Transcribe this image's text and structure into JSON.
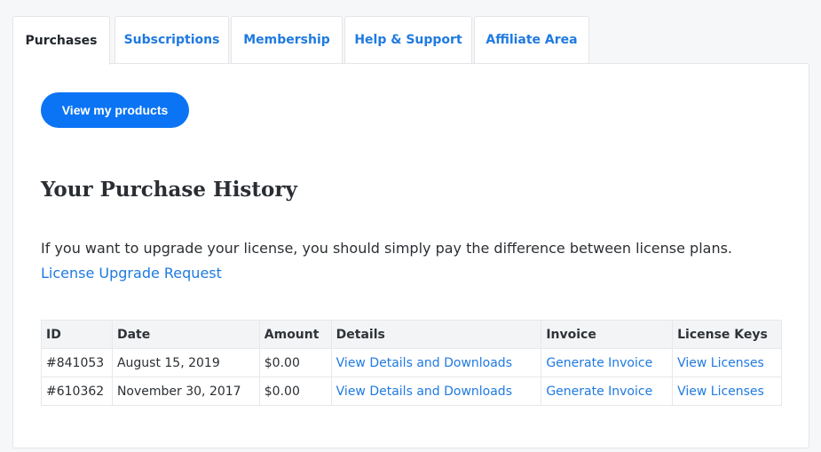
{
  "tabs": [
    {
      "label": "Purchases",
      "active": true
    },
    {
      "label": "Subscriptions",
      "active": false
    },
    {
      "label": "Membership",
      "active": false
    },
    {
      "label": "Help & Support",
      "active": false
    },
    {
      "label": "Affiliate Area",
      "active": false
    }
  ],
  "view_products_label": "View my products",
  "heading": "Your Purchase History",
  "intro": {
    "text": "If you want to upgrade your license, you should simply pay the difference between license plans. ",
    "link": "License Upgrade Request"
  },
  "table": {
    "headers": [
      "ID",
      "Date",
      "Amount",
      "Details",
      "Invoice",
      "License Keys"
    ],
    "rows": [
      {
        "id": "#841053",
        "date": "August 15, 2019",
        "amount": "$0.00",
        "details": "View Details and Downloads",
        "invoice": "Generate Invoice",
        "keys": "View Licenses"
      },
      {
        "id": "#610362",
        "date": "November 30, 2017",
        "amount": "$0.00",
        "details": "View Details and Downloads",
        "invoice": "Generate Invoice",
        "keys": "View Licenses"
      }
    ]
  },
  "colors": {
    "accent": "#0b74f5",
    "link": "#1f7ae0"
  }
}
